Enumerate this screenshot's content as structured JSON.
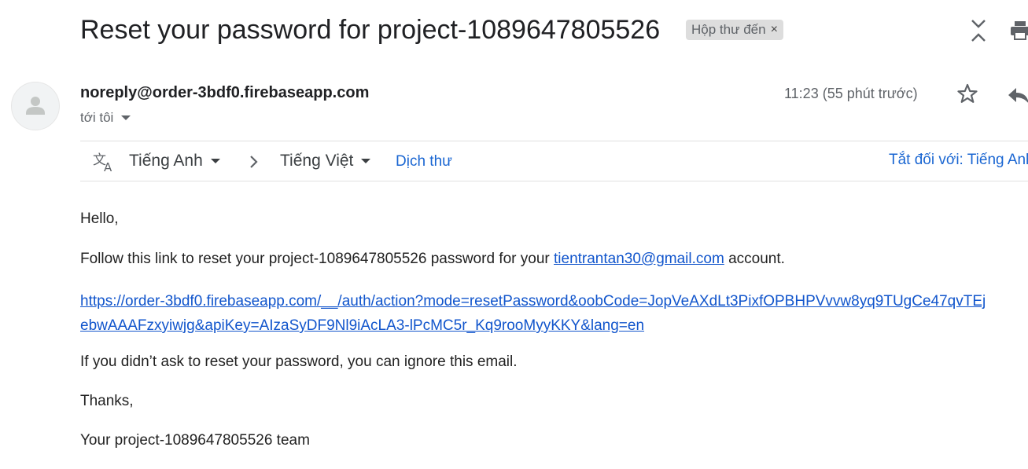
{
  "email": {
    "subject": "Reset your password for project-1089647805526",
    "label_chip": "Hộp thư đến",
    "label_chip_remove": "×",
    "sender": "noreply@order-3bdf0.firebaseapp.com",
    "recipient": "tới tôi",
    "time": "11:23 (55 phút trước)"
  },
  "translate_bar": {
    "from_language": "Tiếng Anh",
    "to_language": "Tiếng Việt",
    "translate_label": "Dịch thư",
    "turn_off_label": "Tắt đối với: Tiếng Anh"
  },
  "body": {
    "greeting": "Hello,",
    "line1_prefix": "Follow this link to reset your project-1089647805526 password for your ",
    "line1_email": "tientrantan30@gmail.com",
    "line1_suffix": " account.",
    "reset_link": "https://order-3bdf0.firebaseapp.com/__/auth/action?mode=resetPassword&oobCode=JopVeAXdLt3PixfOPBHPVvvw8yq9TUgCe47qvTEjebwAAAFzxyiwjg&apiKey=AIzaSyDF9Nl9iAcLA3-lPcMC5r_Kq9rooMyyKKY&lang=en",
    "ignore_line": "If you didn’t ask to reset your password, you can ignore this email.",
    "thanks": "Thanks,",
    "signature": "Your project-1089647805526 team"
  },
  "icons": {
    "expand": "unfold-icon",
    "print": "print-icon",
    "avatar": "person-icon",
    "star": "star-icon",
    "reply": "reply-icon",
    "translate": "translate-icon",
    "arrow": "chevron-right-icon"
  },
  "colors": {
    "link": "#1155cc",
    "action_link": "#1a66d2",
    "chip_bg": "#dddddd"
  }
}
